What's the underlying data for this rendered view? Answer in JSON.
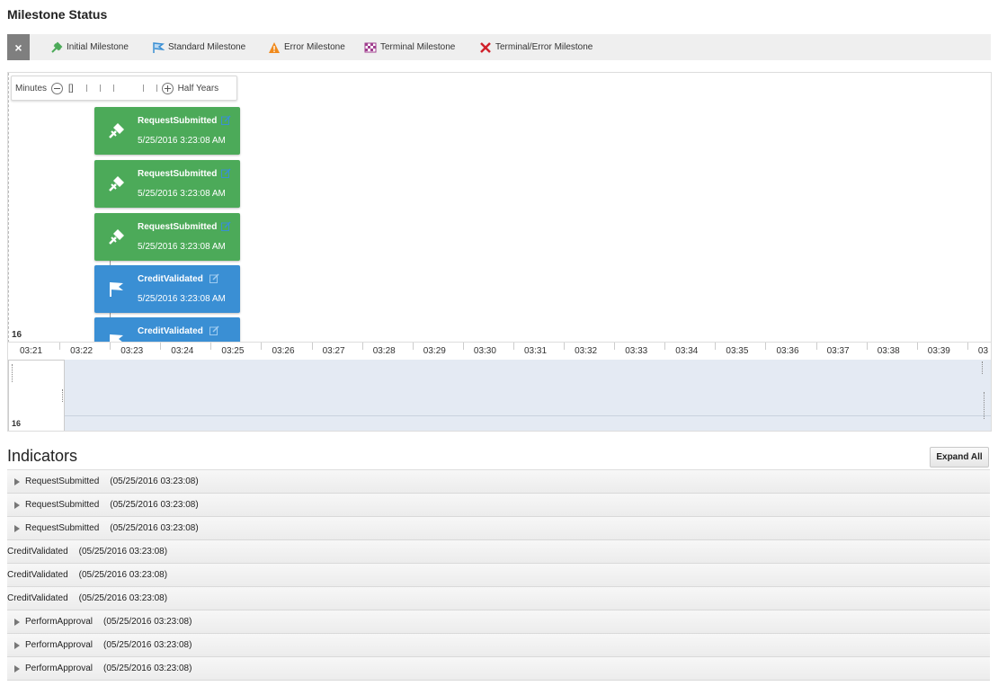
{
  "page": {
    "title": "Milestone Status"
  },
  "legend": {
    "close_label": "×",
    "items": [
      {
        "label": "Initial Milestone",
        "icon": "initial-milestone-icon",
        "color": "#4caa59"
      },
      {
        "label": "Standard Milestone",
        "icon": "standard-milestone-icon",
        "color": "#3a8fd4"
      },
      {
        "label": "Error Milestone",
        "icon": "error-milestone-icon",
        "color": "#f08a1d"
      },
      {
        "label": "Terminal Milestone",
        "icon": "terminal-milestone-icon",
        "color": "#a13f8f"
      },
      {
        "label": "Terminal/Error Milestone",
        "icon": "terminal-error-milestone-icon",
        "color": "#d0202a"
      }
    ]
  },
  "zoom": {
    "min_label": "Minutes",
    "max_label": "Half Years",
    "bracket": "[]"
  },
  "timeline": {
    "row_label": "16",
    "cards": [
      {
        "title": "RequestSubmitted",
        "date": "5/25/2016 3:23:08 AM",
        "kind": "initial",
        "color": "#4caa59"
      },
      {
        "title": "RequestSubmitted",
        "date": "5/25/2016 3:23:08 AM",
        "kind": "initial",
        "color": "#4caa59"
      },
      {
        "title": "RequestSubmitted",
        "date": "5/25/2016 3:23:08 AM",
        "kind": "initial",
        "color": "#4caa59"
      },
      {
        "title": "CreditValidated",
        "date": "5/25/2016 3:23:08 AM",
        "kind": "standard",
        "color": "#3a8fd4"
      },
      {
        "title": "CreditValidated",
        "date": "",
        "kind": "standard",
        "color": "#3a8fd4"
      }
    ],
    "axis_ticks": [
      "03:21",
      "03:22",
      "03:23",
      "03:24",
      "03:25",
      "03:26",
      "03:27",
      "03:28",
      "03:29",
      "03:30",
      "03:31",
      "03:32",
      "03:33",
      "03:34",
      "03:35",
      "03:36",
      "03:37",
      "03:38",
      "03:39",
      "03"
    ],
    "overview_label": "16"
  },
  "indicators": {
    "title": "Indicators",
    "expand_label": "Expand All",
    "rows": [
      {
        "name": "RequestSubmitted",
        "time": "(05/25/2016 03:23:08)",
        "expandable": true
      },
      {
        "name": "RequestSubmitted",
        "time": "(05/25/2016 03:23:08)",
        "expandable": true
      },
      {
        "name": "RequestSubmitted",
        "time": "(05/25/2016 03:23:08)",
        "expandable": true
      },
      {
        "name": "CreditValidated",
        "time": "(05/25/2016 03:23:08)",
        "expandable": false
      },
      {
        "name": "CreditValidated",
        "time": "(05/25/2016 03:23:08)",
        "expandable": false
      },
      {
        "name": "CreditValidated",
        "time": "(05/25/2016 03:23:08)",
        "expandable": false
      },
      {
        "name": "PerformApproval",
        "time": "(05/25/2016 03:23:08)",
        "expandable": true
      },
      {
        "name": "PerformApproval",
        "time": "(05/25/2016 03:23:08)",
        "expandable": true
      },
      {
        "name": "PerformApproval",
        "time": "(05/25/2016 03:23:08)",
        "expandable": true
      }
    ]
  }
}
